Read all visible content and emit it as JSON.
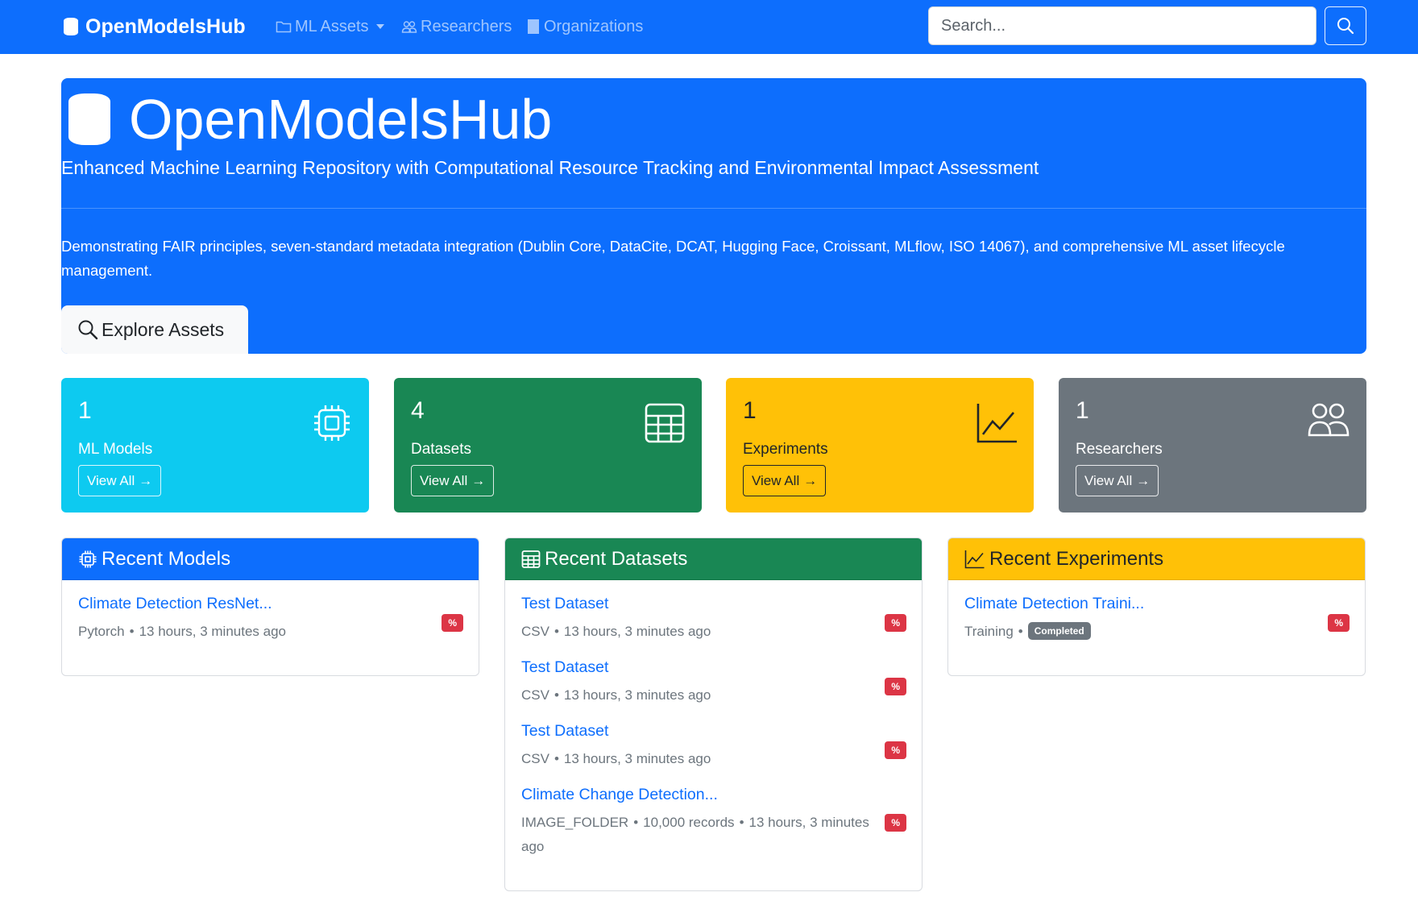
{
  "navbar": {
    "brand": "OpenModelsHub",
    "items": [
      {
        "label": "ML Assets",
        "icon": "folder-icon",
        "dropdown": true
      },
      {
        "label": "Researchers",
        "icon": "people-icon"
      },
      {
        "label": "Organizations",
        "icon": "building-icon"
      }
    ],
    "search": {
      "placeholder": "Search...",
      "value": ""
    }
  },
  "hero": {
    "title": "OpenModelsHub",
    "subtitle": "Enhanced Machine Learning Repository with Computational Resource Tracking and Environmental Impact Assessment",
    "description": "Demonstrating FAIR principles, seven-standard metadata integration (Dublin Core, DataCite, DCAT, Hugging Face, Croissant, MLflow, ISO 14067), and comprehensive ML asset lifecycle management.",
    "button": "Explore Assets"
  },
  "stats": [
    {
      "count": "1",
      "label": "ML Models",
      "button": "View All",
      "icon": "cpu-icon",
      "color": "#0dcaf0"
    },
    {
      "count": "4",
      "label": "Datasets",
      "button": "View All",
      "icon": "table-icon",
      "color": "#198754"
    },
    {
      "count": "1",
      "label": "Experiments",
      "button": "View All",
      "icon": "chart-line-icon",
      "color": "#ffc107"
    },
    {
      "count": "1",
      "label": "Researchers",
      "button": "View All",
      "icon": "people-icon",
      "color": "#6c757d"
    }
  ],
  "recent_models": {
    "title": "Recent Models",
    "items": [
      {
        "title": "Climate Detection ResNet...",
        "type": "Pytorch",
        "time": "13 hours, 3 minutes ago",
        "badge": "%"
      }
    ]
  },
  "recent_datasets": {
    "title": "Recent Datasets",
    "items": [
      {
        "title": "Test Dataset",
        "format": "CSV",
        "time": "13 hours, 3 minutes ago",
        "badge": "%"
      },
      {
        "title": "Test Dataset",
        "format": "CSV",
        "time": "13 hours, 3 minutes ago",
        "badge": "%"
      },
      {
        "title": "Test Dataset",
        "format": "CSV",
        "time": "13 hours, 3 minutes ago",
        "badge": "%"
      },
      {
        "title": "Climate Change Detection...",
        "format": "IMAGE_FOLDER",
        "records": "10,000 records",
        "time": "13 hours, 3 minutes ago",
        "badge": "%"
      }
    ]
  },
  "recent_experiments": {
    "title": "Recent Experiments",
    "items": [
      {
        "title": "Climate Detection Traini...",
        "type": "Training",
        "status": "Completed",
        "badge": "%"
      }
    ]
  },
  "colors": {
    "primary": "#0d6efd",
    "info": "#0dcaf0",
    "success": "#198754",
    "warning": "#ffc107",
    "secondary": "#6c757d",
    "danger": "#dc3545"
  }
}
